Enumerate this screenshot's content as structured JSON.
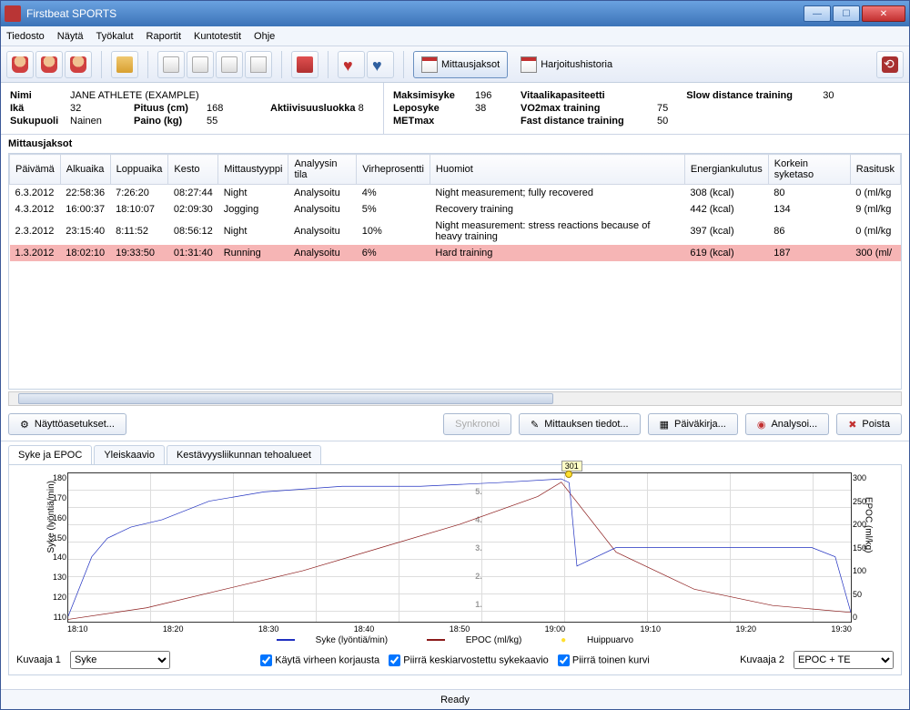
{
  "window": {
    "title": "Firstbeat SPORTS"
  },
  "menu": [
    "Tiedosto",
    "Näytä",
    "Työkalut",
    "Raportit",
    "Kuntotestit",
    "Ohje"
  ],
  "toolbar": {
    "mittausjaksot": "Mittausjaksot",
    "harjoitushistoria": "Harjoitushistoria"
  },
  "athlete": {
    "nimi_lbl": "Nimi",
    "nimi": "JANE ATHLETE (EXAMPLE)",
    "ika_lbl": "Ikä",
    "ika": "32",
    "pituus_lbl": "Pituus (cm)",
    "pituus": "168",
    "aktiivisuus_lbl": "Aktiivisuusluokka",
    "aktiivisuus": "8",
    "sukupuoli_lbl": "Sukupuoli",
    "sukupuoli": "Nainen",
    "paino_lbl": "Paino (kg)",
    "paino": "55"
  },
  "stats": {
    "maksimisyke_lbl": "Maksimisyke",
    "maksimisyke": "196",
    "leposyke_lbl": "Leposyke",
    "leposyke": "38",
    "metmax_lbl": "METmax",
    "metmax": "",
    "vitaali_lbl": "Vitaalikapasiteetti",
    "vitaali": "",
    "vo2_lbl": "VO2max training",
    "vo2": "75",
    "fast_lbl": "Fast distance training",
    "fast": "50",
    "slow_lbl": "Slow distance training",
    "slow": "30"
  },
  "section": "Mittausjaksot",
  "columns": [
    "Päivämä",
    "Alkuaika",
    "Loppuaika",
    "Kesto",
    "Mittaustyyppi",
    "Analyysin tila",
    "Virheprosentti",
    "Huomiot",
    "Energiankulutus",
    "Korkein syketaso",
    "Rasitusk"
  ],
  "rows": [
    {
      "d": "6.3.2012",
      "s": "22:58:36",
      "e": "7:26:20",
      "dur": "08:27:44",
      "type": "Night",
      "st": "Analysoitu",
      "err": "4%",
      "note": "Night measurement; fully recovered",
      "en": "308 (kcal)",
      "hr": "80",
      "ra": "0 (ml/kg"
    },
    {
      "d": "4.3.2012",
      "s": "16:00:37",
      "e": "18:10:07",
      "dur": "02:09:30",
      "type": "Jogging",
      "st": "Analysoitu",
      "err": "5%",
      "note": "Recovery training",
      "en": "442 (kcal)",
      "hr": "134",
      "ra": "9 (ml/kg"
    },
    {
      "d": "2.3.2012",
      "s": "23:15:40",
      "e": "8:11:52",
      "dur": "08:56:12",
      "type": "Night",
      "st": "Analysoitu",
      "err": "10%",
      "note": "Night measurement: stress reactions because of heavy training",
      "en": "397 (kcal)",
      "hr": "86",
      "ra": "0 (ml/kg"
    },
    {
      "d": "1.3.2012",
      "s": "18:02:10",
      "e": "19:33:50",
      "dur": "01:31:40",
      "type": "Running",
      "st": "Analysoitu",
      "err": "6%",
      "note": "Hard training",
      "en": "619 (kcal)",
      "hr": "187",
      "ra": "300 (ml/",
      "sel": true
    }
  ],
  "buttons": {
    "naytto": "Näyttöasetukset...",
    "synk": "Synkronoi",
    "tiedot": "Mittauksen tiedot...",
    "paiva": "Päiväkirja...",
    "analysoi": "Analysoi...",
    "poista": "Poista"
  },
  "tabs": [
    "Syke ja EPOC",
    "Yleiskaavio",
    "Kestävyysliikunnan tehoalueet"
  ],
  "chart_data": {
    "type": "line",
    "title": "",
    "xlabel": "",
    "y1label": "Syke (lyöntiä/min)",
    "y2label": "EPOC (ml/kg)",
    "y1_ticks": [
      110,
      120,
      130,
      140,
      150,
      160,
      170,
      180
    ],
    "y2_ticks": [
      0,
      50,
      100,
      150,
      200,
      250,
      300
    ],
    "x_ticks": [
      "18:10",
      "18:20",
      "18:30",
      "18:40",
      "18:50",
      "19:00",
      "19:10",
      "19:20",
      "19:30"
    ],
    "series": [
      {
        "name": "Syke (lyöntiä/min)",
        "color": "#2030c0",
        "axis": "y1",
        "x": [
          0,
          3,
          5,
          8,
          12,
          18,
          25,
          35,
          45,
          55,
          63,
          64,
          65,
          70,
          78,
          88,
          95,
          98,
          100
        ],
        "y": [
          108,
          140,
          150,
          156,
          160,
          170,
          175,
          178,
          178,
          180,
          182,
          180,
          135,
          145,
          145,
          145,
          145,
          140,
          110
        ]
      },
      {
        "name": "EPOC (ml/kg)",
        "color": "#8b1a1a",
        "axis": "y2",
        "x": [
          0,
          10,
          20,
          30,
          40,
          50,
          60,
          63,
          70,
          80,
          90,
          100
        ],
        "y": [
          5,
          30,
          70,
          110,
          160,
          210,
          270,
          301,
          150,
          70,
          35,
          20
        ]
      }
    ],
    "peak": {
      "label": "301",
      "x_pct": 64,
      "name": "Huippuarvo"
    },
    "te_marks": [
      "5.",
      "4.",
      "3.",
      "2.",
      "1."
    ]
  },
  "legend": {
    "syke": "Syke (lyöntiä/min)",
    "epoc": "EPOC (ml/kg)",
    "peak": "Huippuarvo"
  },
  "controls": {
    "kuvaaja1_lbl": "Kuvaaja 1",
    "kuvaaja1": "Syke",
    "kuvaaja2_lbl": "Kuvaaja 2",
    "kuvaaja2": "EPOC + TE",
    "cb1": "Käytä virheen korjausta",
    "cb2": "Piirrä keskiarvostettu sykekaavio",
    "cb3": "Piirrä toinen kurvi"
  },
  "status": "Ready"
}
